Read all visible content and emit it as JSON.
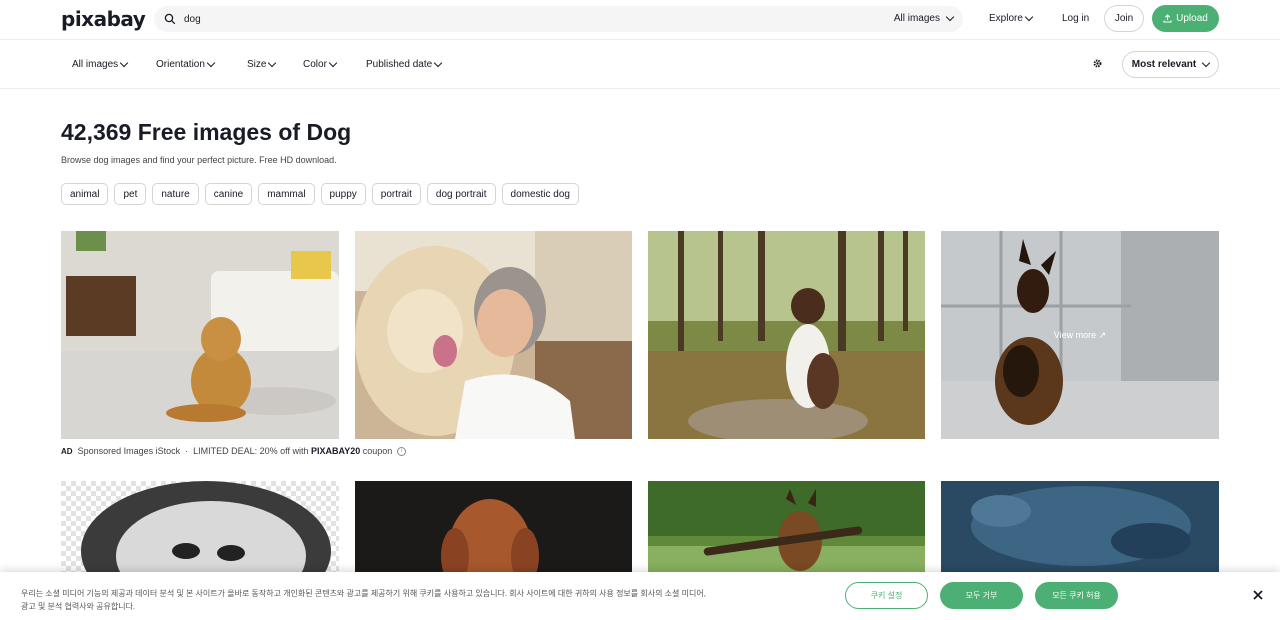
{
  "header": {
    "logo": "pixabay",
    "search_value": "dog",
    "search_scope": "All images",
    "explore": "Explore",
    "login": "Log in",
    "join": "Join",
    "upload": "Upload"
  },
  "filters": {
    "items": [
      "All images",
      "Orientation",
      "Size",
      "Color",
      "Published date"
    ],
    "sort": "Most relevant"
  },
  "page": {
    "title": "42,369 Free images of Dog",
    "subtitle": "Browse dog images and find your perfect picture. Free HD download.",
    "tags": [
      "animal",
      "pet",
      "nature",
      "canine",
      "mammal",
      "puppy",
      "portrait",
      "dog portrait",
      "domestic dog"
    ]
  },
  "sponsored": {
    "ad": "AD",
    "label": "Sponsored Images iStock",
    "dot": "·",
    "deal_prefix": "LIMITED DEAL: 20% off with",
    "code": "PIXABAY20",
    "deal_suffix": "coupon",
    "view_more": "View more"
  },
  "cookie": {
    "text": "우리는 소셜 미디어 기능의 제공과 데이터 분석 및 본 사이트가 올바로 동작하고 개인화된 콘텐츠와 광고를 제공하기 위해 쿠키를 사용하고 있습니다. 회사 사이트에 대한 귀하의 사용 정보를 회사의 소셜 미디어, 광고 및 분석 협력사와 공유합니다.",
    "settings": "쿠키 설정",
    "reject": "모두 거부",
    "accept": "모든 쿠키 허용"
  },
  "colors": {
    "accent": "#4caf73",
    "text": "#191b26"
  }
}
